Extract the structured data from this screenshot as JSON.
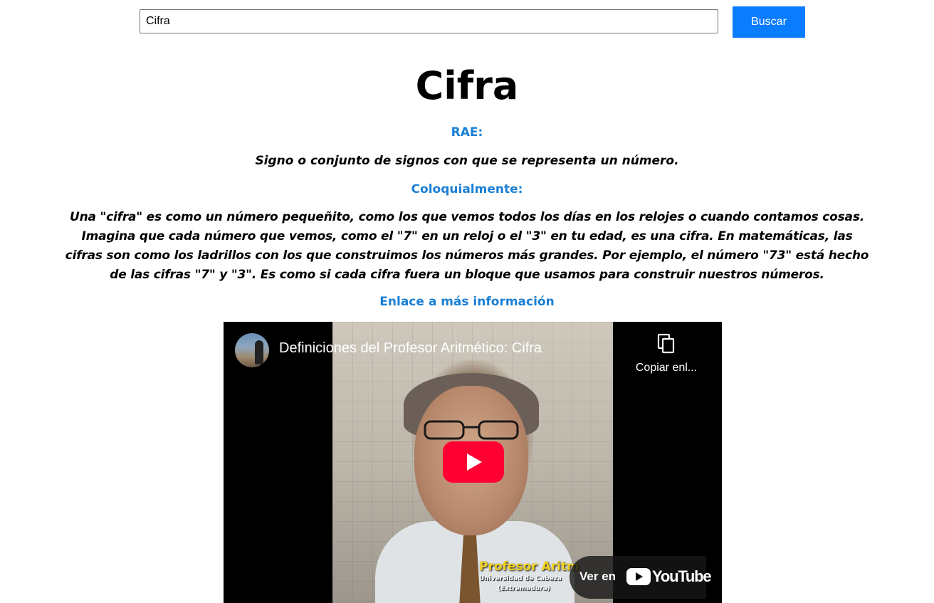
{
  "search": {
    "value": "Cifra",
    "button_label": "Buscar"
  },
  "entry": {
    "title": "Cifra",
    "rae_label": "RAE:",
    "rae_definition": "Signo o conjunto de signos con que se representa un número.",
    "colloquial_label": "Coloquialmente:",
    "colloquial_definition": "Una \"cifra\" es como un número pequeñito, como los que vemos todos los días en los relojes o cuando contamos cosas. Imagina que cada número que vemos, como el \"7\" en un reloj o el \"3\" en tu edad, es una cifra. En matemáticas, las cifras son como los ladrillos con los que construimos los números más grandes. Por ejemplo, el número \"73\" está hecho de las cifras \"7\" y \"3\". Es como si cada cifra fuera un bloque que usamos para construir nuestros números.",
    "more_info_link": "Enlace a más información"
  },
  "video": {
    "title": "Definiciones del Profesor Aritmético: Cifra",
    "copy_link_label": "Copiar enl...",
    "watch_on_label": "Ver en",
    "youtube_wordmark": "YouTube",
    "thumbnail_caption_1": "Profesor Aritm",
    "thumbnail_caption_2": "Universidad de Cabeza",
    "thumbnail_caption_3": "(Extremadura)",
    "icons": {
      "copy": "copy-icon",
      "play": "play-icon",
      "youtube": "youtube-logo-icon"
    }
  },
  "colors": {
    "accent_blue": "#0a7cff",
    "label_blue": "#1a7fd4",
    "youtube_red": "#ff0033"
  }
}
